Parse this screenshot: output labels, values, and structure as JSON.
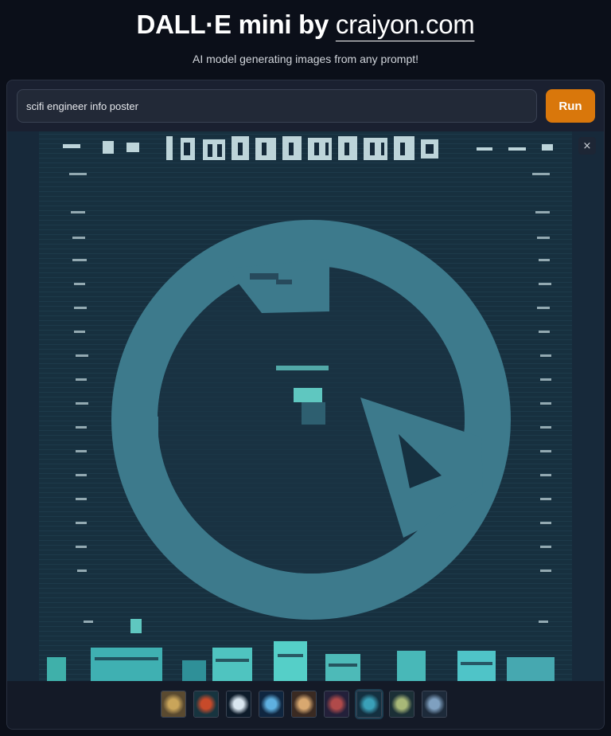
{
  "header": {
    "title_prefix": "DALL·E mini by ",
    "title_link": "craiyon.com",
    "subtitle": "AI model generating images from any prompt!"
  },
  "prompt": {
    "value": "scifi engineer info poster",
    "placeholder": ""
  },
  "run_button": {
    "label": "Run"
  },
  "preview": {
    "close_symbol": "×",
    "icon": "close-icon"
  },
  "gallery": {
    "thumbnails": [
      {
        "name": "thumbnail-1",
        "bg": "#5a4a30",
        "accent": "#c9a55a"
      },
      {
        "name": "thumbnail-2",
        "bg": "#17343f",
        "accent": "#c74a2a"
      },
      {
        "name": "thumbnail-3",
        "bg": "#0d1b2a",
        "accent": "#d9e6f0"
      },
      {
        "name": "thumbnail-4",
        "bg": "#0f2640",
        "accent": "#5fb0e0"
      },
      {
        "name": "thumbnail-5",
        "bg": "#3a2a22",
        "accent": "#d8a870"
      },
      {
        "name": "thumbnail-6",
        "bg": "#23203a",
        "accent": "#b04a4a"
      },
      {
        "name": "thumbnail-7",
        "bg": "#143040",
        "accent": "#3aa0b8"
      },
      {
        "name": "thumbnail-8",
        "bg": "#1b2f36",
        "accent": "#a8b878"
      },
      {
        "name": "thumbnail-9",
        "bg": "#1d2a3a",
        "accent": "#7fa0c0"
      }
    ],
    "selected_index": 6
  },
  "colors": {
    "background": "#0b0f19",
    "run_button": "#d9770b",
    "image_base": "#152b3c",
    "circle": "#3d7a8c"
  }
}
